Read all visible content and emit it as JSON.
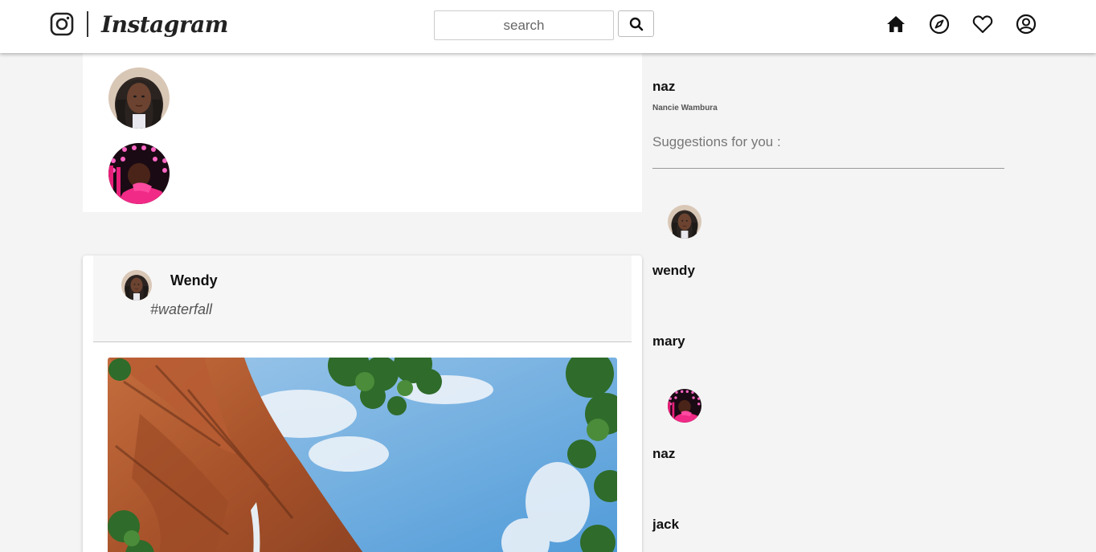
{
  "navbar": {
    "brand_name": "Instagram",
    "search": {
      "placeholder": "search",
      "value": ""
    },
    "icons": [
      "home-icon",
      "compass-icon",
      "heart-icon",
      "user-circle-icon"
    ]
  },
  "stories": {
    "avatars": [
      "avatar-braids",
      "avatar-pink"
    ]
  },
  "post": {
    "author": "Wendy",
    "caption": "#waterfall",
    "image": "waterfall-photo"
  },
  "sidebar": {
    "username": "naz",
    "fullname": "Nancie Wambura",
    "suggestions_title": "Suggestions for you :",
    "suggestions": [
      {
        "name": "wendy",
        "avatar": "avatar-braids"
      },
      {
        "name": "mary",
        "avatar": ""
      },
      {
        "name": "naz",
        "avatar": "avatar-pink"
      },
      {
        "name": "jack",
        "avatar": ""
      }
    ]
  },
  "colors": {
    "page_bg": "#f4f4f4",
    "card_bg": "#ffffff",
    "sky": "#5aa6e0",
    "rock": "#b5643a",
    "pink": "#e8207a"
  }
}
